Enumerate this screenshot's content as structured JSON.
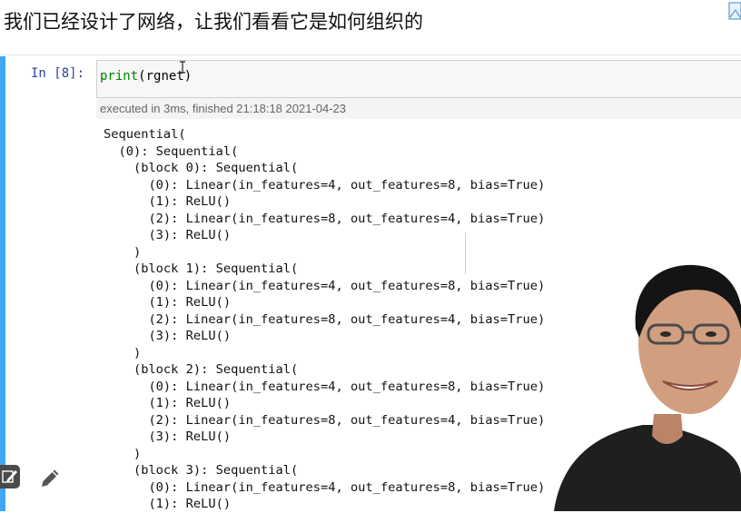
{
  "caption": {
    "text": "我们已经设计了网络，让我们看看它是如何组织的"
  },
  "cell": {
    "prompt": "In [8]:",
    "code": {
      "func": "print",
      "rest": "(rgnet)"
    },
    "exec_info": "executed in 3ms, finished 21:18:18 2021-04-23",
    "output_lines": [
      "Sequential(",
      "  (0): Sequential(",
      "    (block 0): Sequential(",
      "      (0): Linear(in_features=4, out_features=8, bias=True)",
      "      (1): ReLU()",
      "      (2): Linear(in_features=8, out_features=4, bias=True)",
      "      (3): ReLU()",
      "    )",
      "    (block 1): Sequential(",
      "      (0): Linear(in_features=4, out_features=8, bias=True)",
      "      (1): ReLU()",
      "      (2): Linear(in_features=8, out_features=4, bias=True)",
      "      (3): ReLU()",
      "    )",
      "    (block 2): Sequential(",
      "      (0): Linear(in_features=4, out_features=8, bias=True)",
      "      (1): ReLU()",
      "      (2): Linear(in_features=8, out_features=4, bias=True)",
      "      (3): ReLU()",
      "    )",
      "    (block 3): Sequential(",
      "      (0): Linear(in_features=4, out_features=8, bias=True)",
      "      (1): ReLU()"
    ]
  },
  "icons": {
    "corner": "image-icon",
    "edit": "edit-mode-icon",
    "pencil": "pencil-icon",
    "cursor": "text-cursor-icon"
  },
  "colors": {
    "cell_bar": "#42a5f5",
    "prompt": "#303f9f",
    "builtin": "#008000"
  }
}
